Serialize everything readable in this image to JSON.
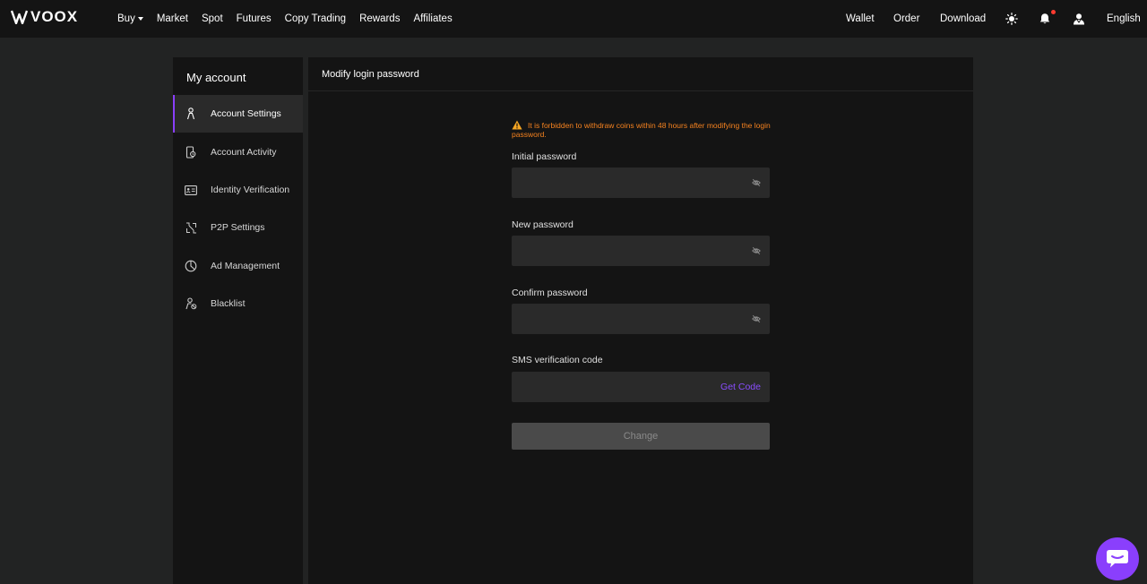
{
  "brand": {
    "name": "VOOX"
  },
  "nav": {
    "left": [
      {
        "label": "Buy",
        "has_caret": true
      },
      {
        "label": "Market"
      },
      {
        "label": "Spot"
      },
      {
        "label": "Futures"
      },
      {
        "label": "Copy Trading"
      },
      {
        "label": "Rewards"
      },
      {
        "label": "Affiliates"
      }
    ],
    "right": {
      "wallet": "Wallet",
      "order": "Order",
      "download": "Download",
      "theme_icon": "sun-icon",
      "notification_icon": "bell-icon",
      "user_icon": "user-icon",
      "language": "English"
    }
  },
  "sidebar": {
    "title": "My account",
    "items": [
      {
        "label": "Account Settings",
        "icon": "person-icon",
        "active": true
      },
      {
        "label": "Account Activity",
        "icon": "phone-clock-icon"
      },
      {
        "label": "Identity Verification",
        "icon": "id-card-icon"
      },
      {
        "label": "P2P Settings",
        "icon": "p2p-icon"
      },
      {
        "label": "Ad Management",
        "icon": "pie-chart-icon"
      },
      {
        "label": "Blacklist",
        "icon": "user-block-icon"
      }
    ]
  },
  "main": {
    "title": "Modify login password",
    "warning": "It is forbidden to withdraw coins within 48 hours after modifying the login password.",
    "fields": {
      "initial": {
        "label": "Initial password",
        "value": ""
      },
      "new": {
        "label": "New password",
        "value": ""
      },
      "confirm": {
        "label": "Confirm password",
        "value": ""
      },
      "sms": {
        "label": "SMS verification code",
        "value": "",
        "action": "Get Code"
      }
    },
    "submit": "Change"
  },
  "colors": {
    "accent": "#8a3ffc",
    "warning": "#f5821f",
    "background": "#222323",
    "panel": "#141414",
    "input": "#2a2a2a"
  }
}
